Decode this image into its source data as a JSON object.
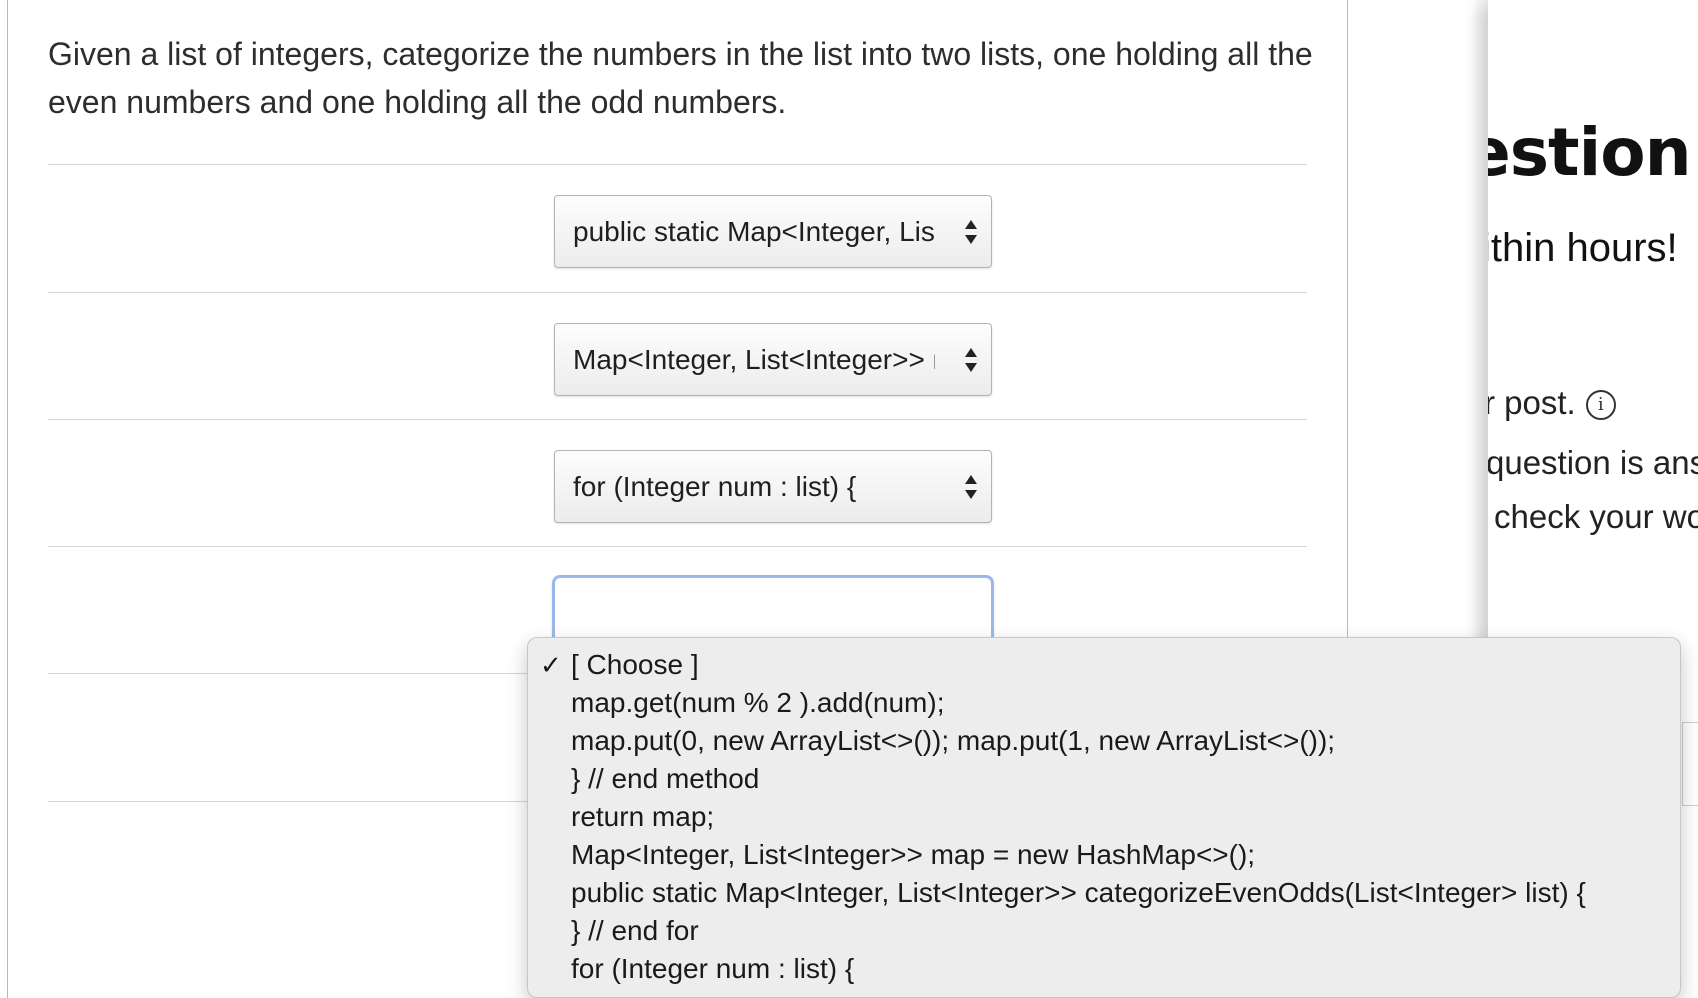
{
  "question": {
    "text": "Given a list of integers, categorize the numbers in the list into two lists, one holding all the even numbers and one holding all the odd numbers."
  },
  "selects": [
    {
      "value": "public static Map<Integer, List<Integer>> categorizeEvenOdds(List<Integer> list) {"
    },
    {
      "value": "Map<Integer, List<Integer>> map = new HashMap<>();"
    },
    {
      "value": "for (Integer num : list) {"
    },
    {
      "value": ""
    }
  ],
  "dropdown": {
    "selected_marker": "✓",
    "options": [
      "[ Choose ]",
      "map.get(num % 2 ).add(num);",
      "map.put(0, new ArrayList<>()); map.put(1, new ArrayList<>());",
      "} // end method",
      "return map;",
      "Map<Integer, List<Integer>> map = new HashMap<>();",
      "public static Map<Integer, List<Integer>> categorizeEvenOdds(List<Integer> list) {",
      "} // end for",
      "for (Integer num : list) {"
    ]
  },
  "side_panel": {
    "heading": "estion",
    "subheading": "ithin hours!",
    "line1": "r post.",
    "line2": "question is answ",
    "line3": "check your wo"
  },
  "icons": {
    "select_arrows": "up-down-arrows-icon",
    "info": "info-icon",
    "checkmark": "checkmark-icon"
  },
  "colors": {
    "focus_ring": "#9ab8ec",
    "dropdown_bg": "#ededed",
    "text": "#2d2d2d"
  }
}
